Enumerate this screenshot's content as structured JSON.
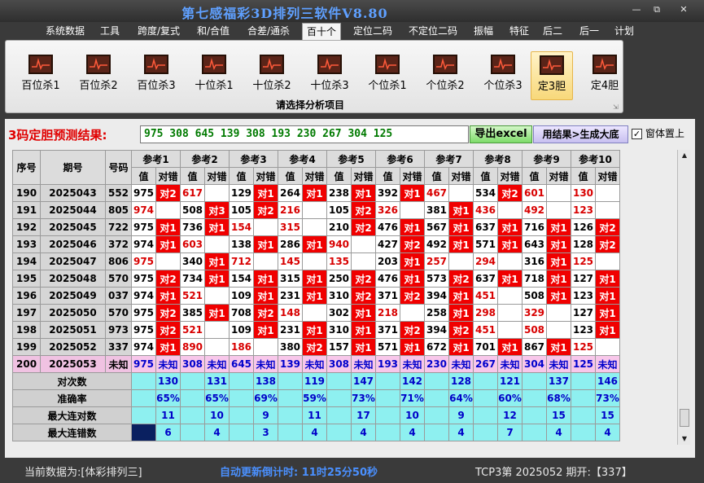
{
  "app": {
    "title": "第七感福彩3D排列三软件V8.80"
  },
  "window_controls": {
    "minimize": "—",
    "restore": "⧉",
    "close": "✕"
  },
  "menu": [
    {
      "label": "系统数据"
    },
    {
      "label": "工具"
    },
    {
      "label": "跨度/复式"
    },
    {
      "label": "和/合值"
    },
    {
      "label": "合差/通杀"
    },
    {
      "label": "百十个"
    },
    {
      "label": "定位二码"
    },
    {
      "label": "不定位二码"
    },
    {
      "label": "振幅"
    },
    {
      "label": "特征"
    },
    {
      "label": "后二"
    },
    {
      "label": "后一"
    },
    {
      "label": "计划"
    }
  ],
  "menu_active": "百十个",
  "ribbon": {
    "caption": "请选择分析项目",
    "corner": "⇲",
    "buttons": [
      {
        "label": "百位杀1"
      },
      {
        "label": "百位杀2"
      },
      {
        "label": "百位杀3"
      },
      {
        "label": "十位杀1"
      },
      {
        "label": "十位杀2"
      },
      {
        "label": "十位杀3"
      },
      {
        "label": "个位杀1"
      },
      {
        "label": "个位杀2"
      },
      {
        "label": "个位杀3"
      },
      {
        "label": "定3胆"
      },
      {
        "label": "定4胆"
      }
    ],
    "active": "定3胆"
  },
  "prediction": {
    "label": "3码定胆预测结果:",
    "value": "975 308 645 139 308 193 230 267 304 125",
    "excel_button": "导出excel",
    "generate_button": "用结果>生成大底",
    "ontop_label": "窗体置上",
    "ontop_checked": "✓"
  },
  "table": {
    "head_row1": {
      "seq": "序号",
      "issue": "期号",
      "number": "号码"
    },
    "groups": [
      "参考1",
      "参考2",
      "参考3",
      "参考4",
      "参考5",
      "参考6",
      "参考7",
      "参考8",
      "参考9",
      "参考10"
    ],
    "sub_val": "值",
    "sub_dc": "对错",
    "rows": [
      {
        "seq": "190",
        "issue": "2025043",
        "num": "552",
        "cells": [
          [
            "975",
            "对2"
          ],
          [
            "617",
            ""
          ],
          [
            "129",
            "对1"
          ],
          [
            "264",
            "对1"
          ],
          [
            "238",
            "对1"
          ],
          [
            "392",
            "对1"
          ],
          [
            "467",
            ""
          ],
          [
            "534",
            "对2"
          ],
          [
            "601",
            ""
          ],
          [
            "130",
            ""
          ]
        ]
      },
      {
        "seq": "191",
        "issue": "2025044",
        "num": "805",
        "cells": [
          [
            "974",
            ""
          ],
          [
            "508",
            "对3"
          ],
          [
            "105",
            "对2"
          ],
          [
            "216",
            ""
          ],
          [
            "105",
            "对2"
          ],
          [
            "326",
            ""
          ],
          [
            "381",
            "对1"
          ],
          [
            "436",
            ""
          ],
          [
            "492",
            ""
          ],
          [
            "123",
            ""
          ]
        ]
      },
      {
        "seq": "192",
        "issue": "2025045",
        "num": "722",
        "cells": [
          [
            "975",
            "对1"
          ],
          [
            "736",
            "对1"
          ],
          [
            "154",
            ""
          ],
          [
            "315",
            ""
          ],
          [
            "210",
            "对2"
          ],
          [
            "476",
            "对1"
          ],
          [
            "567",
            "对1"
          ],
          [
            "637",
            "对1"
          ],
          [
            "716",
            "对1"
          ],
          [
            "126",
            "对2"
          ]
        ]
      },
      {
        "seq": "193",
        "issue": "2025046",
        "num": "372",
        "cells": [
          [
            "974",
            "对1"
          ],
          [
            "603",
            ""
          ],
          [
            "138",
            "对1"
          ],
          [
            "286",
            "对1"
          ],
          [
            "940",
            ""
          ],
          [
            "427",
            "对2"
          ],
          [
            "492",
            "对1"
          ],
          [
            "571",
            "对1"
          ],
          [
            "643",
            "对1"
          ],
          [
            "128",
            "对2"
          ]
        ]
      },
      {
        "seq": "194",
        "issue": "2025047",
        "num": "806",
        "cells": [
          [
            "975",
            ""
          ],
          [
            "340",
            "对1"
          ],
          [
            "712",
            ""
          ],
          [
            "145",
            ""
          ],
          [
            "135",
            ""
          ],
          [
            "203",
            "对1"
          ],
          [
            "257",
            ""
          ],
          [
            "294",
            ""
          ],
          [
            "316",
            "对1"
          ],
          [
            "125",
            ""
          ]
        ]
      },
      {
        "seq": "195",
        "issue": "2025048",
        "num": "570",
        "cells": [
          [
            "975",
            "对2"
          ],
          [
            "734",
            "对1"
          ],
          [
            "154",
            "对1"
          ],
          [
            "315",
            "对1"
          ],
          [
            "250",
            "对2"
          ],
          [
            "476",
            "对1"
          ],
          [
            "573",
            "对2"
          ],
          [
            "637",
            "对1"
          ],
          [
            "718",
            "对1"
          ],
          [
            "127",
            "对1"
          ]
        ]
      },
      {
        "seq": "196",
        "issue": "2025049",
        "num": "037",
        "cells": [
          [
            "974",
            "对1"
          ],
          [
            "521",
            ""
          ],
          [
            "109",
            "对1"
          ],
          [
            "231",
            "对1"
          ],
          [
            "310",
            "对2"
          ],
          [
            "371",
            "对2"
          ],
          [
            "394",
            "对1"
          ],
          [
            "451",
            ""
          ],
          [
            "508",
            "对1"
          ],
          [
            "123",
            "对1"
          ]
        ]
      },
      {
        "seq": "197",
        "issue": "2025050",
        "num": "570",
        "cells": [
          [
            "975",
            "对2"
          ],
          [
            "385",
            "对1"
          ],
          [
            "708",
            "对2"
          ],
          [
            "148",
            ""
          ],
          [
            "302",
            "对1"
          ],
          [
            "218",
            ""
          ],
          [
            "258",
            "对1"
          ],
          [
            "298",
            ""
          ],
          [
            "329",
            ""
          ],
          [
            "127",
            "对1"
          ]
        ]
      },
      {
        "seq": "198",
        "issue": "2025051",
        "num": "973",
        "cells": [
          [
            "975",
            "对2"
          ],
          [
            "521",
            ""
          ],
          [
            "109",
            "对1"
          ],
          [
            "231",
            "对1"
          ],
          [
            "310",
            "对1"
          ],
          [
            "371",
            "对2"
          ],
          [
            "394",
            "对2"
          ],
          [
            "451",
            ""
          ],
          [
            "508",
            ""
          ],
          [
            "123",
            "对1"
          ]
        ]
      },
      {
        "seq": "199",
        "issue": "2025052",
        "num": "337",
        "cells": [
          [
            "974",
            "对1"
          ],
          [
            "890",
            ""
          ],
          [
            "186",
            ""
          ],
          [
            "380",
            "对2"
          ],
          [
            "157",
            "对1"
          ],
          [
            "571",
            "对1"
          ],
          [
            "672",
            "对1"
          ],
          [
            "701",
            "对1"
          ],
          [
            "867",
            "对1"
          ],
          [
            "125",
            ""
          ]
        ]
      }
    ],
    "unknown_row": {
      "seq": "200",
      "issue": "2025053",
      "num": "未知",
      "cells": [
        [
          "975",
          "未知"
        ],
        [
          "308",
          "未知"
        ],
        [
          "645",
          "未知"
        ],
        [
          "139",
          "未知"
        ],
        [
          "308",
          "未知"
        ],
        [
          "193",
          "未知"
        ],
        [
          "230",
          "未知"
        ],
        [
          "267",
          "未知"
        ],
        [
          "304",
          "未知"
        ],
        [
          "125",
          "未知"
        ]
      ]
    },
    "stats": [
      {
        "label": "对次数",
        "values": [
          "130",
          "131",
          "138",
          "119",
          "147",
          "142",
          "128",
          "121",
          "137",
          "146"
        ]
      },
      {
        "label": "准确率",
        "values": [
          "65%",
          "65%",
          "69%",
          "59%",
          "73%",
          "71%",
          "64%",
          "60%",
          "68%",
          "73%"
        ]
      },
      {
        "label": "最大连对数",
        "values": [
          "11",
          "10",
          "9",
          "11",
          "17",
          "10",
          "9",
          "12",
          "15",
          "15"
        ]
      },
      {
        "label": "最大连错数",
        "values": [
          "6",
          "4",
          "3",
          "4",
          "4",
          "4",
          "4",
          "7",
          "4",
          "4"
        ]
      }
    ]
  },
  "status": {
    "current": "当前数据为:[体彩排列三]",
    "countdown": "自动更新倒计时: 11时25分50秒",
    "draw": "TCP3第 2025052 期开:【337】"
  },
  "colors": {
    "title": "#5fa0ff",
    "hit": "#f00000",
    "unknown_row": "#f8c7ea",
    "stats": "#8ef0f0",
    "countdown": "#4a90ff"
  }
}
